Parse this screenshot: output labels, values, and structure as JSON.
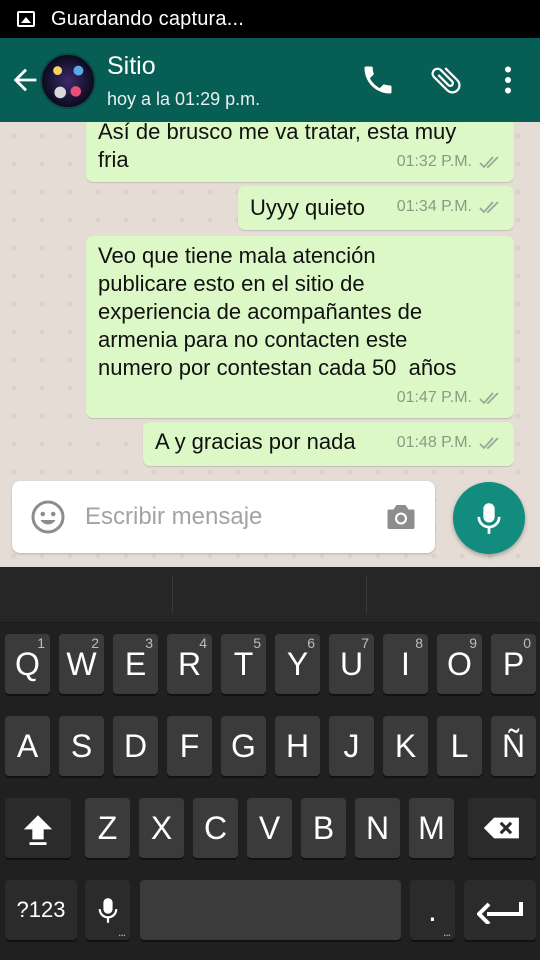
{
  "status_bar": {
    "text": "Guardando captura..."
  },
  "header": {
    "contact_name": "Sitio",
    "last_seen": "hoy a la 01:29 p.m."
  },
  "messages": [
    {
      "text": "Así de brusco me va tratar, esta muy\nfria",
      "time": "01:32 P.M."
    },
    {
      "text": "Uyyy quieto",
      "time": "01:34 P.M."
    },
    {
      "text": "Veo que tiene mala atención\npublicare esto en el sitio de\nexperiencia de acompañantes de\narmenia para no contacten este\nnumero por contestan cada 50  años",
      "time": "01:47 P.M."
    },
    {
      "text": "A y gracias por nada",
      "time": "01:48 P.M."
    }
  ],
  "composer": {
    "placeholder": "Escribir mensaje"
  },
  "keyboard": {
    "row1": [
      {
        "label": "Q",
        "hint": "1"
      },
      {
        "label": "W",
        "hint": "2"
      },
      {
        "label": "E",
        "hint": "3"
      },
      {
        "label": "R",
        "hint": "4"
      },
      {
        "label": "T",
        "hint": "5"
      },
      {
        "label": "Y",
        "hint": "6"
      },
      {
        "label": "U",
        "hint": "7"
      },
      {
        "label": "I",
        "hint": "8"
      },
      {
        "label": "O",
        "hint": "9"
      },
      {
        "label": "P",
        "hint": "0"
      }
    ],
    "row2": [
      "A",
      "S",
      "D",
      "F",
      "G",
      "H",
      "J",
      "K",
      "L",
      "Ñ"
    ],
    "row3": [
      "Z",
      "X",
      "C",
      "V",
      "B",
      "N",
      "M"
    ],
    "symbols_key": "?123",
    "period_key": "."
  },
  "colors": {
    "header": "#075e54",
    "outgoing_bubble": "#dcf8c6",
    "fab": "#128c7e",
    "chat_bg": "#e5ddd5"
  }
}
